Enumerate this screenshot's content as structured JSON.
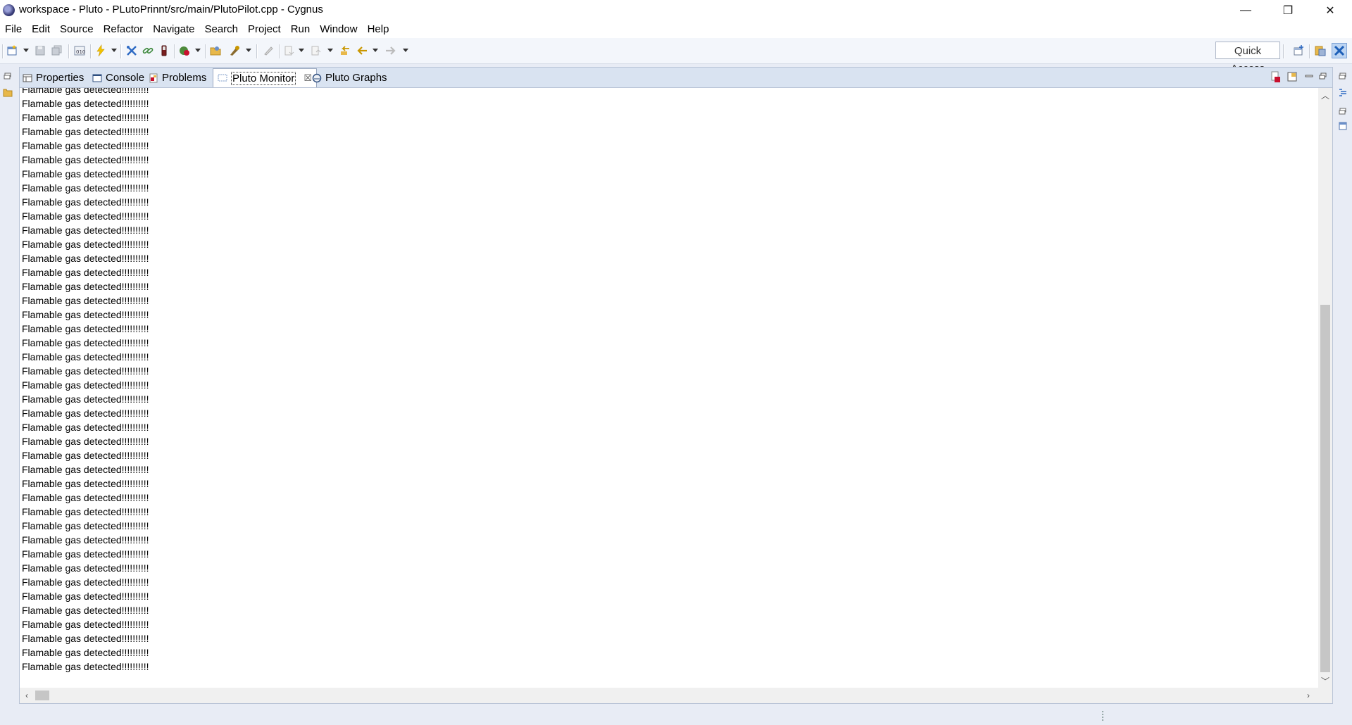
{
  "window": {
    "title": "workspace - Pluto - PLutoPrinnt/src/main/PlutoPilot.cpp - Cygnus",
    "controls": [
      "—",
      "❐",
      "✕"
    ]
  },
  "menu": [
    "File",
    "Edit",
    "Source",
    "Refactor",
    "Navigate",
    "Search",
    "Project",
    "Run",
    "Window",
    "Help"
  ],
  "quick_access": "Quick Access",
  "tabs": [
    {
      "label": "Properties",
      "icon": "properties-icon"
    },
    {
      "label": "Console",
      "icon": "console-icon"
    },
    {
      "label": "Problems",
      "icon": "problems-icon"
    },
    {
      "label": "Pluto Monitor",
      "icon": "monitor-icon",
      "active": true
    },
    {
      "label": "Pluto Graphs",
      "icon": "graphs-icon"
    }
  ],
  "console": {
    "partial_line": "Flamable gas detected!!!!!!!!!!",
    "line_text": "Flamable gas detected!!!!!!!!!!",
    "line_count": 41
  },
  "colors": {
    "terminate_red": "#c8102e",
    "tab_bar": "#d9e3f1",
    "background": "#e8ecf5"
  }
}
